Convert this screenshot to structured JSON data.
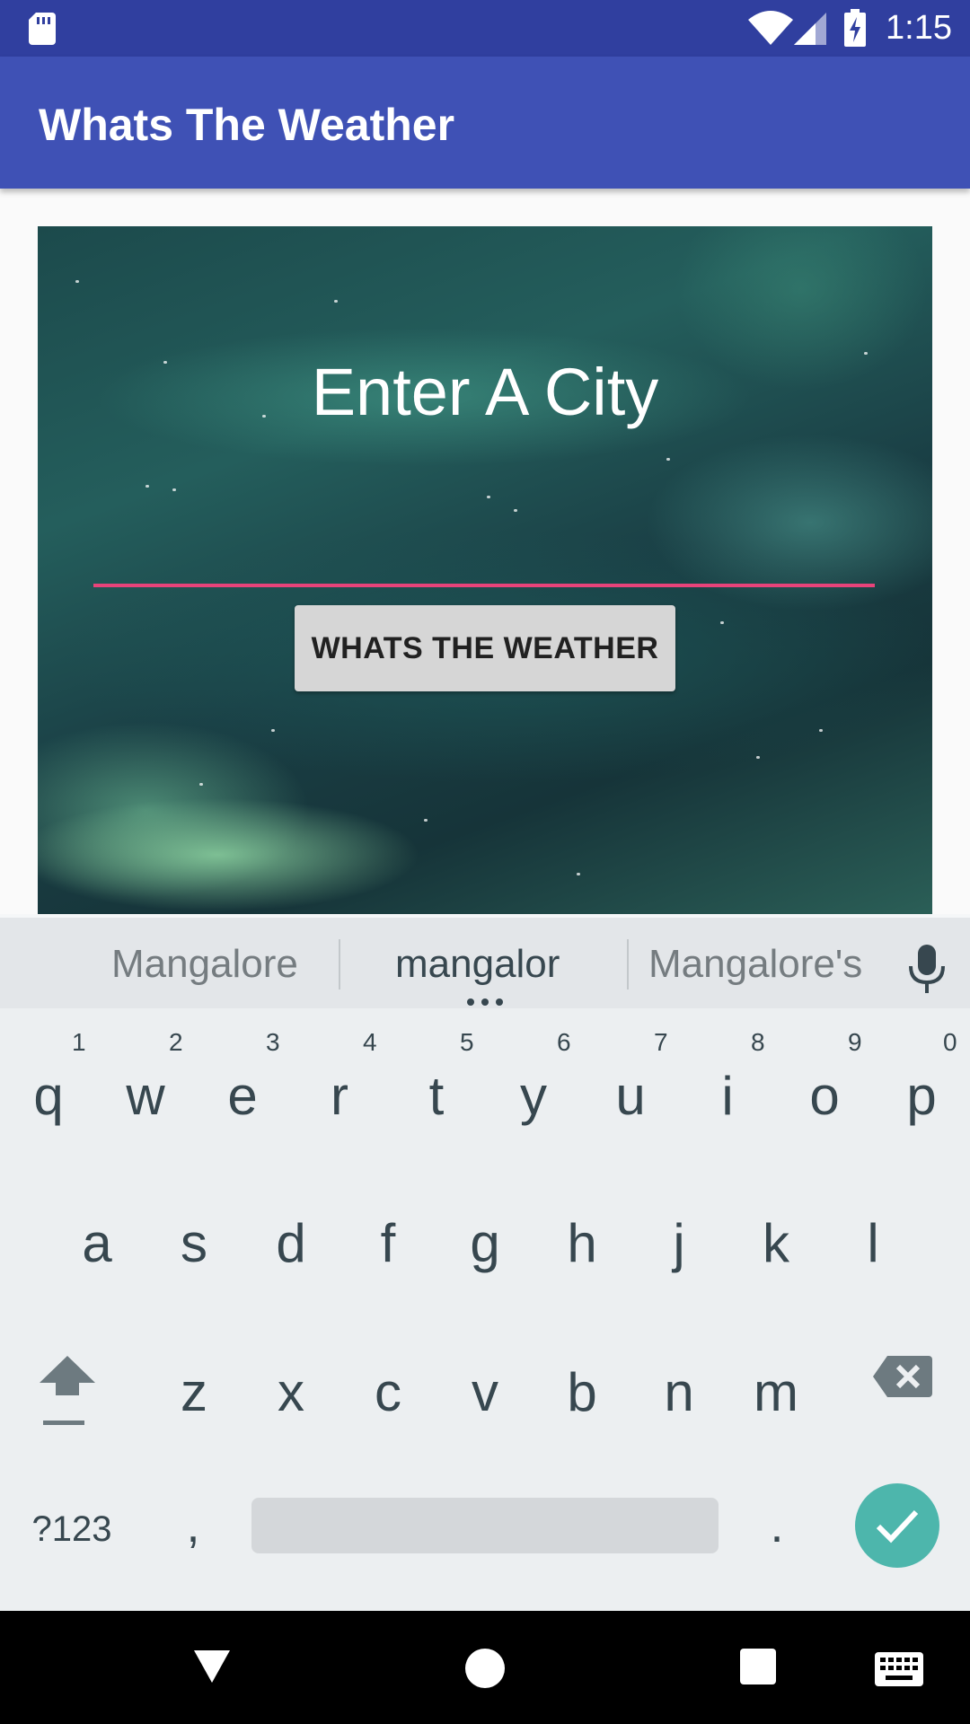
{
  "status_bar": {
    "time": "1:15",
    "icons": [
      "sd-card-icon",
      "wifi-icon",
      "signal-icon",
      "battery-charging-icon"
    ],
    "background": "#303f9f"
  },
  "app_bar": {
    "title": "Whats The Weather",
    "background": "#3f51b5"
  },
  "main": {
    "heading": "Enter A City",
    "city_input_value": "",
    "button_label": "WHATS THE WEATHER",
    "input_underline_color": "#e8437a"
  },
  "keyboard": {
    "suggestions": [
      "Mangalore",
      "mangalor",
      "Mangalore's"
    ],
    "row1": [
      {
        "key": "q",
        "num": "1"
      },
      {
        "key": "w",
        "num": "2"
      },
      {
        "key": "e",
        "num": "3"
      },
      {
        "key": "r",
        "num": "4"
      },
      {
        "key": "t",
        "num": "5"
      },
      {
        "key": "y",
        "num": "6"
      },
      {
        "key": "u",
        "num": "7"
      },
      {
        "key": "i",
        "num": "8"
      },
      {
        "key": "o",
        "num": "9"
      },
      {
        "key": "p",
        "num": "0"
      }
    ],
    "row2": [
      "a",
      "s",
      "d",
      "f",
      "g",
      "h",
      "j",
      "k",
      "l"
    ],
    "row3": [
      "z",
      "x",
      "c",
      "v",
      "b",
      "n",
      "m"
    ],
    "symbols_key": "?123",
    "comma_key": ",",
    "period_key": ".",
    "enter_color": "#4db6ac"
  },
  "nav_bar": {
    "icons": [
      "back-icon",
      "home-icon",
      "recents-icon",
      "keyboard-switch-icon"
    ]
  }
}
